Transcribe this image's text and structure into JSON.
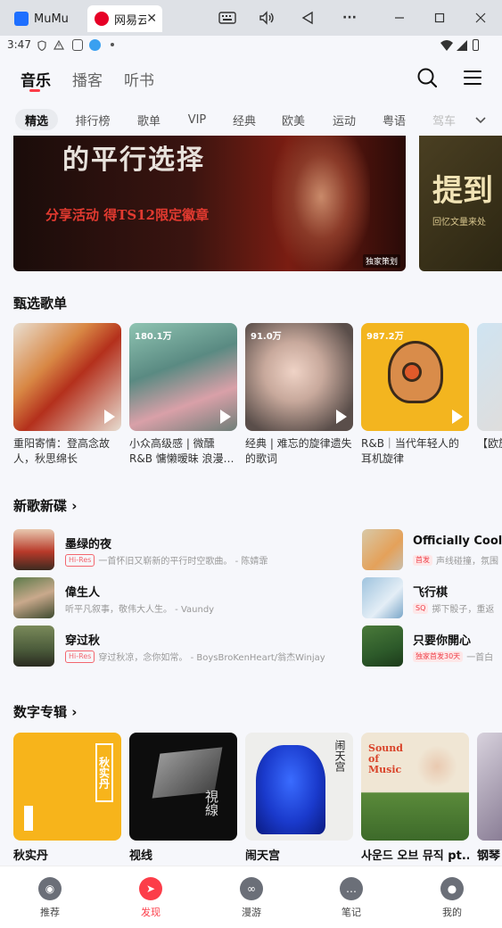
{
  "window": {
    "tabs": [
      {
        "label": "MuMu"
      },
      {
        "label": "网易云"
      }
    ],
    "close_symbol": "✕"
  },
  "status": {
    "time": "3:47"
  },
  "top_tabs": [
    {
      "label": "音乐"
    },
    {
      "label": "播客"
    },
    {
      "label": "听书"
    }
  ],
  "categories": [
    {
      "label": "精选"
    },
    {
      "label": "排行榜"
    },
    {
      "label": "歌单"
    },
    {
      "label": "VIP"
    },
    {
      "label": "经典"
    },
    {
      "label": "欧美"
    },
    {
      "label": "运动"
    },
    {
      "label": "粤语"
    },
    {
      "label": "驾车"
    }
  ],
  "banners": {
    "main_text": "的平行选择",
    "main_sub": "分享活动 得TS12限定徽章",
    "main_tag": "独家策划",
    "side_text": "提到",
    "side_sub": "回忆文量来处"
  },
  "playlists": {
    "title": "甄选歌单",
    "items": [
      {
        "count": "",
        "caption": "重阳寄情：登高念故人，秋思绵长"
      },
      {
        "count": "180.1万",
        "caption": "小众高级感 | 微醺R&B 慵懒暧昧 浪漫…"
      },
      {
        "count": "91.0万",
        "caption": "经典 | 难忘的旋律遗失的歌词"
      },
      {
        "count": "987.2万",
        "caption": "R&B｜当代年轻人的耳机旋律"
      },
      {
        "count": "",
        "caption": "【欧旋律"
      }
    ]
  },
  "new_songs": {
    "title": "新歌新碟 ›",
    "left": [
      {
        "title": "墨绿的夜",
        "badge": "Hi-Res",
        "sub": "一首怀旧又崭新的平行时空歌曲。 - 陈婧霏"
      },
      {
        "title": "偉生人",
        "badge": "",
        "sub": "听平凡叙事，敬伟大人生。 - Vaundy"
      },
      {
        "title": "穿过秋",
        "badge": "Hi-Res",
        "sub": "穿过秋凉，念你如常。 - BoysBroKenHeart/翁杰Winjay"
      }
    ],
    "right": [
      {
        "title": "Officially Cool (V",
        "badge": "首发",
        "sub": "声线碰撞，氛围"
      },
      {
        "title": "飞行棋",
        "badge": "SQ",
        "sub": "掷下骰子，重返"
      },
      {
        "title": "只要你開心",
        "badge": "独家首发30天",
        "sub": "一首白"
      }
    ]
  },
  "albums": {
    "title": "数字专辑 ›",
    "items": [
      {
        "caption": "秋实丹",
        "art_text": "秋实丹"
      },
      {
        "caption": "视线",
        "art_text": "視線"
      },
      {
        "caption": "闹天宫",
        "art_text": "闹天宫"
      },
      {
        "caption": "사운드 오브 뮤직 pt....",
        "art_text": "Sound of Music"
      },
      {
        "caption": "钢琴"
      }
    ]
  },
  "bottom_nav": [
    {
      "label": "推荐"
    },
    {
      "label": "发现"
    },
    {
      "label": "漫游"
    },
    {
      "label": "笔记"
    },
    {
      "label": "我的"
    }
  ],
  "colors": {
    "accent": "#fc3d49",
    "background": "#f6f7fb"
  }
}
